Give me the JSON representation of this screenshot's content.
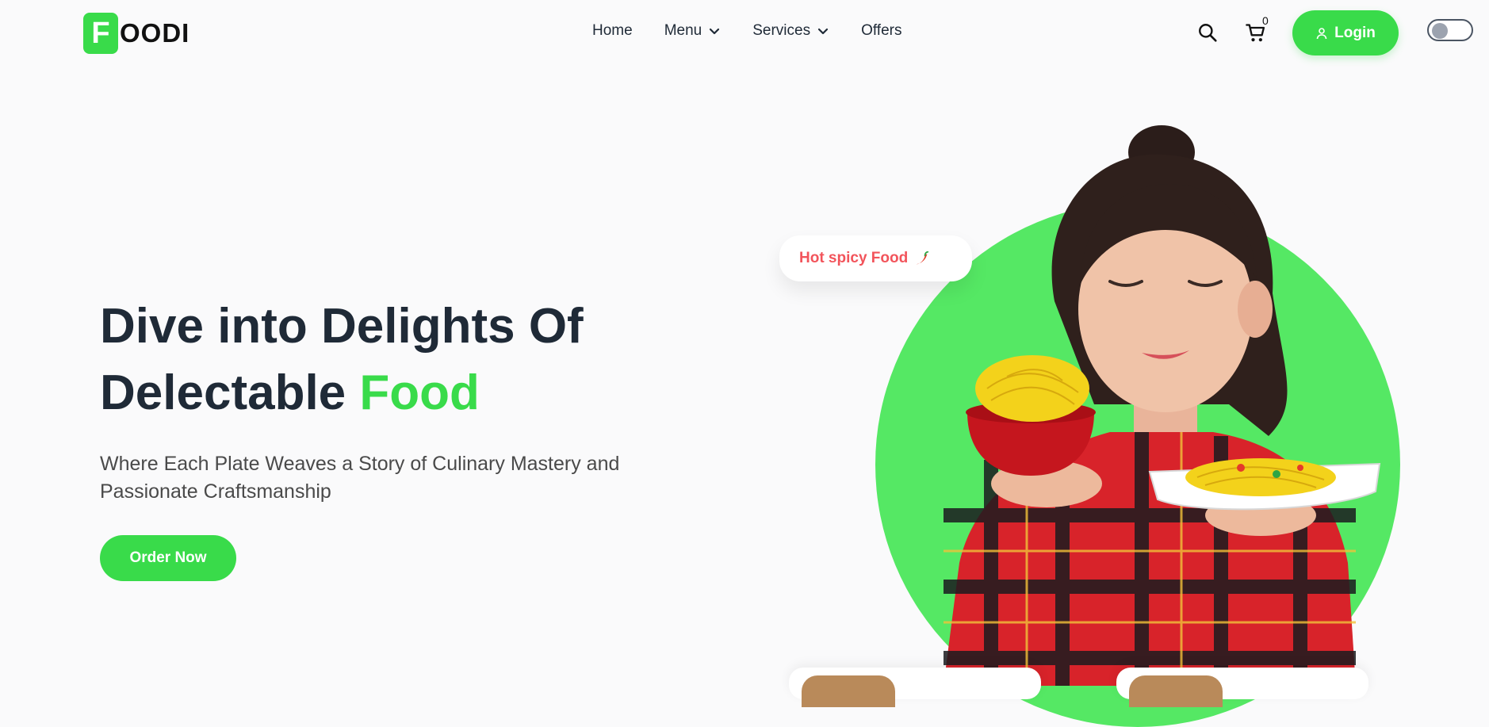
{
  "brand": {
    "logo_letter": "F",
    "logo_text": "OODI",
    "accent": "#39db4a"
  },
  "nav": {
    "items": [
      {
        "label": "Home",
        "has_dropdown": false
      },
      {
        "label": "Menu",
        "has_dropdown": true
      },
      {
        "label": "Services",
        "has_dropdown": true
      },
      {
        "label": "Offers",
        "has_dropdown": false
      }
    ],
    "cart_count": "0",
    "login_label": "Login",
    "icons": {
      "search": "search-icon",
      "cart": "cart-icon",
      "user": "user-icon"
    },
    "theme_toggle": "off"
  },
  "hero": {
    "title_part1": "Dive into Delights Of",
    "title_part2": "Delectable ",
    "title_accent": "Food",
    "subtitle": "Where Each Plate Weaves a Story of Culinary Mastery and Passionate Craftsmanship",
    "cta_label": "Order Now",
    "bubble_text": "Hot spicy Food"
  }
}
